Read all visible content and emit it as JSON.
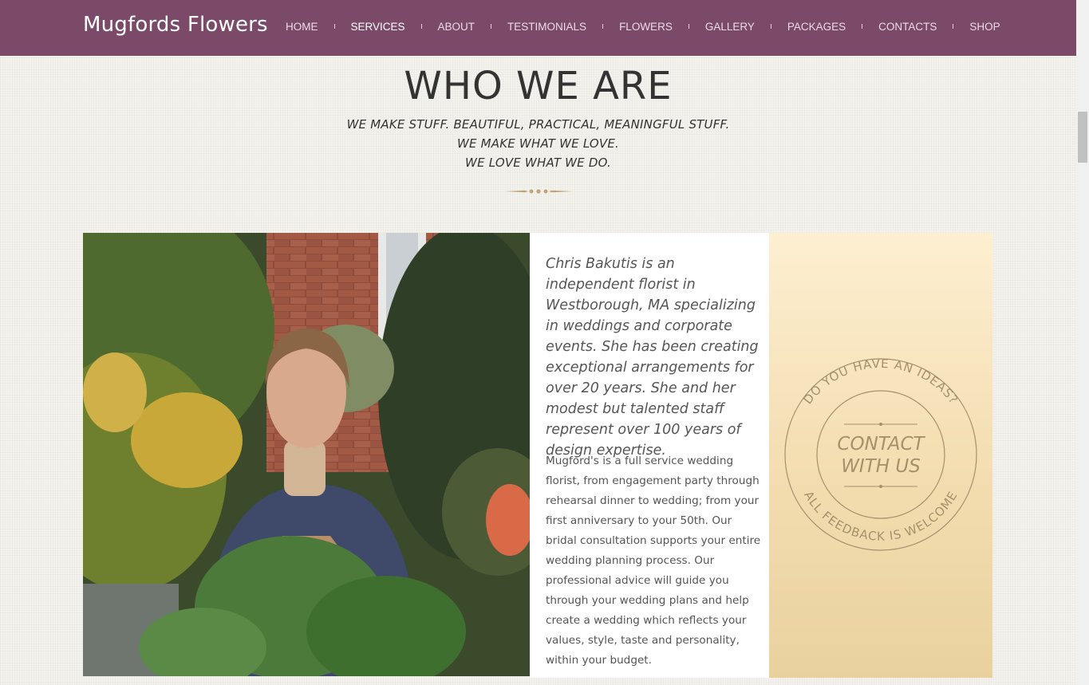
{
  "header": {
    "logo": "Mugfords Flowers",
    "nav": [
      "HOME",
      "SERVICES",
      "ABOUT",
      "TESTIMONIALS",
      "FLOWERS",
      "GALLERY",
      "PACKAGES",
      "CONTACTS",
      "SHOP"
    ],
    "active": "SERVICES"
  },
  "section": {
    "title": "WHO WE ARE",
    "tagline": [
      "WE MAKE STUFF. BEAUTIFUL, PRACTICAL, MEANINGFUL STUFF.",
      "WE MAKE WHAT WE LOVE.",
      "WE LOVE WHAT WE DO."
    ]
  },
  "about": {
    "lead": "Chris Bakutis is an independent florist in Westborough, MA specializing in weddings and corporate events. She has been creating exceptional arrangements for over 20 years. She and her modest but talented staff represent over 100 years of design expertise.",
    "body": "Mugford's is a full service wedding florist, from engagement party through rehearsal dinner to wedding; from your first anniversary to your 50th. Our bridal consultation supports your entire wedding planning process. Our professional advice will guide you through your wedding plans and help create a wedding which reflects your values, style, taste and personality, within your budget."
  },
  "contact_badge": {
    "arc_top": "DO YOU HAVE AN IDEAS?",
    "arc_bottom": "ALL FEEDBACK IS WELCOME",
    "line1": "CONTACT",
    "line2": "WITH US"
  },
  "colors": {
    "header_bg": "#7b4a69",
    "ornament": "#c3a27a",
    "badge_text": "#a5906c"
  }
}
